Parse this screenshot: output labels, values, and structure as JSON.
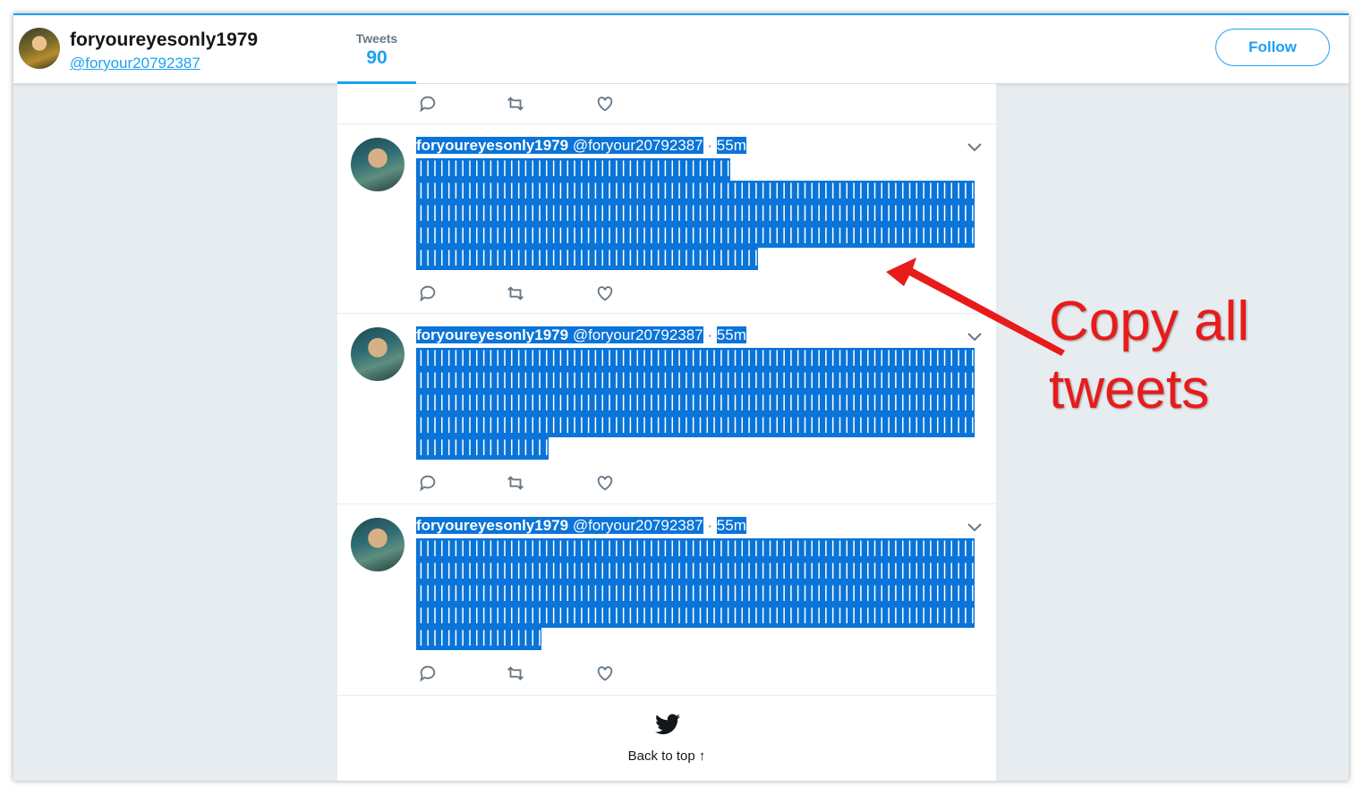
{
  "profile": {
    "name": "foryoureyesonly1979",
    "handle": "@foryour20792387"
  },
  "nav": {
    "tweets_label": "Tweets",
    "tweets_count": "90"
  },
  "follow_button": "Follow",
  "tweets": [
    {
      "name": "foryoureyesonly1979",
      "handle": "@foryour20792387",
      "separator": "·",
      "time": "55m",
      "lines": [
        "|||||||||||||||||||||||||||||||||||||||||||||",
        "||||||||||||||||||||||||||||||||||||||||||||||||||||||||||||||||||||||||||||||||",
        "||||||||||||||||||||||||||||||||||||||||||||||||||||||||||||||||||||||||||||||||",
        "||||||||||||||||||||||||||||||||||||||||||||||||||||||||||||||||||||||||||||||||",
        "|||||||||||||||||||||||||||||||||||||||||||||||||"
      ]
    },
    {
      "name": "foryoureyesonly1979",
      "handle": "@foryour20792387",
      "separator": "·",
      "time": "55m",
      "lines": [
        "||||||||||||||||||||||||||||||||||||||||||||||||||||||||||||||||||||||||||||||||",
        "||||||||||||||||||||||||||||||||||||||||||||||||||||||||||||||||||||||||||||||||",
        "||||||||||||||||||||||||||||||||||||||||||||||||||||||||||||||||||||||||||||||||",
        "||||||||||||||||||||||||||||||||||||||||||||||||||||||||||||||||||||||||||||||||",
        "|||||||||||||||||||"
      ]
    },
    {
      "name": "foryoureyesonly1979",
      "handle": "@foryour20792387",
      "separator": "·",
      "time": "55m",
      "lines": [
        "||||||||||||||||||||||||||||||||||||||||||||||||||||||||||||||||||||||||||||||||",
        "||||||||||||||||||||||||||||||||||||||||||||||||||||||||||||||||||||||||||||||||",
        "||||||||||||||||||||||||||||||||||||||||||||||||||||||||||||||||||||||||||||||||",
        "||||||||||||||||||||||||||||||||||||||||||||||||||||||||||||||||||||||||||||||||",
        "||||||||||||||||||"
      ]
    }
  ],
  "footer": {
    "back_to_top": "Back to top ↑"
  },
  "annotation": {
    "line1": "Copy all",
    "line2": "tweets",
    "color": "#e81b1b"
  },
  "colors": {
    "accent": "#1da1f2",
    "selection": "#0a74d8",
    "background": "#e6ecf0"
  }
}
